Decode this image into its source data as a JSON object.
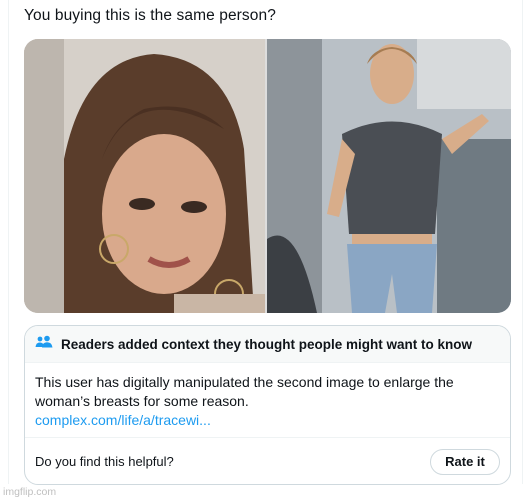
{
  "tweet": {
    "text": "You buying this is the same person?"
  },
  "media": {
    "images": [
      {
        "subject": "close-up selfie of a woman with long brown hair and hoop earrings"
      },
      {
        "subject": "woman in grey tank top and ripped jeans standing in an airplane aisle"
      }
    ]
  },
  "community_note": {
    "icon": "people-icon",
    "header": "Readers added context they thought people might want to know",
    "body": "This user has digitally manipulated the second image to enlarge the woman’s breasts for some reason.",
    "link": "complex.com/life/a/tracewi...",
    "question": "Do you find this helpful?",
    "rate_button": "Rate it"
  },
  "watermark": "imgflip.com",
  "colors": {
    "accent": "#1d9bf0",
    "border": "#cfd9de",
    "text": "#0f1419"
  }
}
